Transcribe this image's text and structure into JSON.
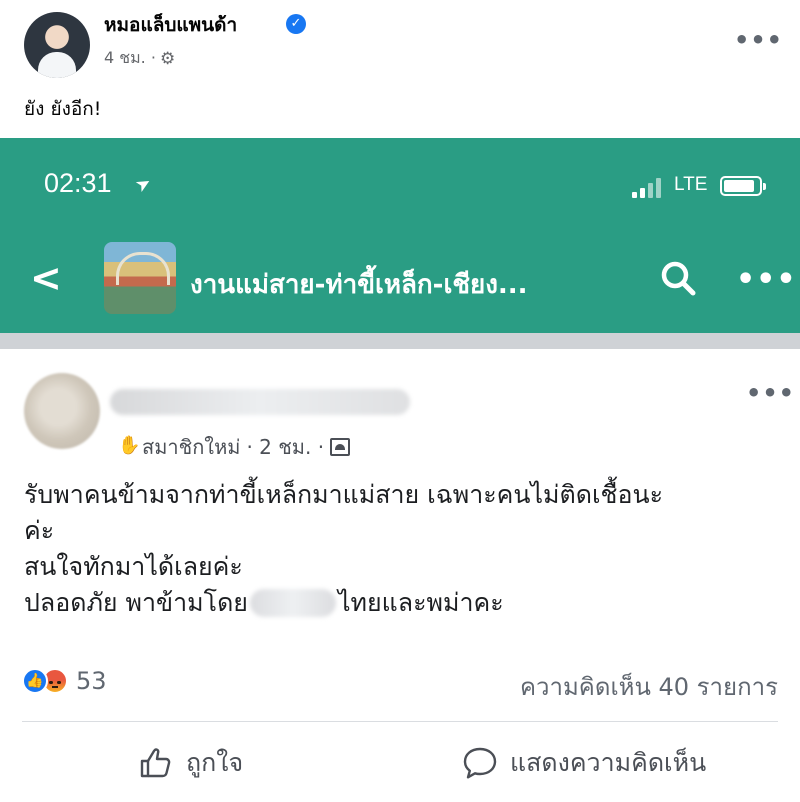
{
  "outer_post": {
    "author": "หมอแล็บแพนด้า",
    "verified_glyph": "✓",
    "time": "4 ชม. ·",
    "privacy_icon": "gear-icon",
    "more_label": "•••",
    "caption": "ยัง ยังอีก!"
  },
  "status_bar": {
    "time": "02:31",
    "location_glyph": "➤",
    "network": "LTE"
  },
  "group_header": {
    "back_glyph": "<",
    "title": "งานแม่สาย-ท่าขี้เหล็ก-เชียง...",
    "more_label": "•••"
  },
  "inner_post": {
    "member_glyph": "✋",
    "member_badge": "สมาชิกใหม่",
    "time": "· 2 ชม. ·",
    "more_label": "•••",
    "body": {
      "line1": "รับพาคนข้ามจากท่าขี้เหล็กมาแม่สาย เฉพาะคนไม่ติดเชื้อนะ",
      "line2": "ค่ะ",
      "line3": "สนใจทักมาได้เลยค่ะ",
      "line4_before": "ปลอดภัย พาข้ามโดย",
      "line4_after": "ไทยและพม่าคะ"
    },
    "like_glyph": "👍",
    "reaction_count": "53",
    "comment_count": "ความคิดเห็น 40 รายการ",
    "actions": {
      "like": "ถูกใจ",
      "comment": "แสดงความคิดเห็น"
    }
  },
  "colors": {
    "header_green": "#2a9d84",
    "facebook_blue": "#1877f2",
    "separator_gray": "#cfd2d6"
  }
}
